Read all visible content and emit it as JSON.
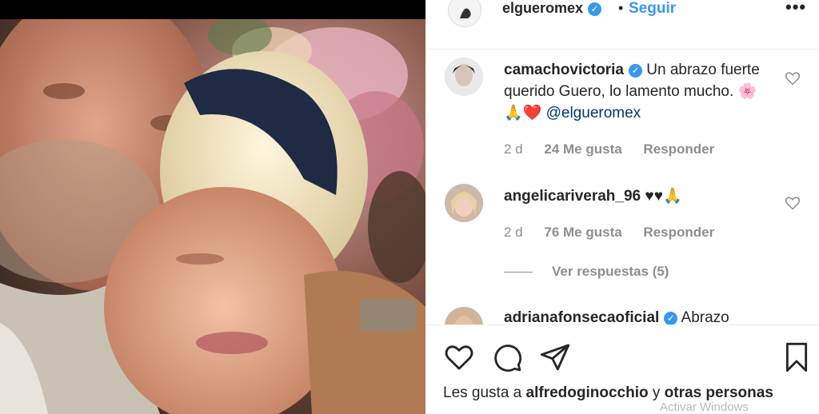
{
  "post": {
    "username": "elgueromex",
    "follow_label": "Seguir",
    "more_label": "•••",
    "dot": "•"
  },
  "comments": [
    {
      "username": "camachovictoria",
      "verified": true,
      "text": "Un abrazo fuerte querido Guero, lo lamento mucho.",
      "emojis": "🌸🙏❤️",
      "mention": "@elgueromex",
      "age": "2 d",
      "likes": "24 Me gusta",
      "reply": "Responder"
    },
    {
      "username": "angelicariverah_96",
      "verified": false,
      "text": "",
      "emojis": "♥♥🙏",
      "mention": "",
      "age": "2 d",
      "likes": "76 Me gusta",
      "reply": "Responder",
      "view_replies": "Ver respuestas (5)"
    },
    {
      "username": "adrianafonsecaoficial",
      "verified": true,
      "text": "Abrazo"
    }
  ],
  "likes_line": {
    "prefix": "Les gusta a",
    "user": "alfredoginocchio",
    "middle": "y",
    "others": "otras personas"
  },
  "icons": [
    "heart-icon",
    "comment-icon",
    "share-icon",
    "bookmark-icon",
    "more-icon",
    "verified-icon"
  ],
  "watermark": "Activar Windows",
  "colors": {
    "accent": "#3897f0",
    "text": "#262626",
    "muted": "#8e8e8e",
    "heart": "#ed4956"
  }
}
